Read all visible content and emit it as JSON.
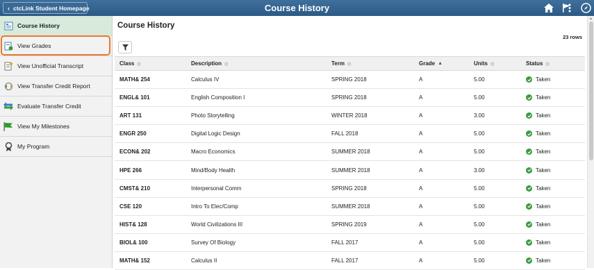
{
  "banner": {
    "back_label": "ctcLink Student Homepage",
    "title": "Course History",
    "color": "#2c5a86"
  },
  "sidebar": {
    "items": [
      {
        "label": "Course History",
        "icon": "course-history-icon",
        "active": true
      },
      {
        "label": "View Grades",
        "icon": "view-grades-icon",
        "active": false
      },
      {
        "label": "View Unofficial Transcript",
        "icon": "transcript-icon",
        "active": false
      },
      {
        "label": "View Transfer Credit Report",
        "icon": "transfer-report-icon",
        "active": false
      },
      {
        "label": "Evaluate Transfer Credit",
        "icon": "evaluate-transfer-icon",
        "active": false
      },
      {
        "label": "View My Milestones",
        "icon": "flag-icon",
        "active": false
      },
      {
        "label": "My Program",
        "icon": "ribbon-icon",
        "active": false
      }
    ]
  },
  "main": {
    "title": "Course History",
    "row_count": "23 rows",
    "columns": [
      "Class",
      "Description",
      "Term",
      "Grade",
      "Units",
      "Status"
    ],
    "rows": [
      {
        "class": "MATH& 254",
        "description": "Calculus IV",
        "term": "SPRING 2018",
        "grade": "A",
        "units": "5.00",
        "status": "Taken"
      },
      {
        "class": "ENGL& 101",
        "description": "English Composition I",
        "term": "SPRING 2018",
        "grade": "A",
        "units": "5.00",
        "status": "Taken"
      },
      {
        "class": "ART 131",
        "description": "Photo Storytelling",
        "term": "WINTER 2018",
        "grade": "A",
        "units": "3.00",
        "status": "Taken"
      },
      {
        "class": "ENGR 250",
        "description": "Digital Logic Design",
        "term": "FALL 2018",
        "grade": "A",
        "units": "5.00",
        "status": "Taken"
      },
      {
        "class": "ECON& 202",
        "description": "Macro Economics",
        "term": "SUMMER 2018",
        "grade": "A",
        "units": "5.00",
        "status": "Taken"
      },
      {
        "class": "HPE 266",
        "description": "Mind/Body Health",
        "term": "SUMMER 2018",
        "grade": "A",
        "units": "3.00",
        "status": "Taken"
      },
      {
        "class": "CMST& 210",
        "description": "Interpersonal Comm",
        "term": "SPRING 2018",
        "grade": "A",
        "units": "5.00",
        "status": "Taken"
      },
      {
        "class": "CSE 120",
        "description": "Intro To Elec/Comp",
        "term": "SUMMER 2018",
        "grade": "A",
        "units": "5.00",
        "status": "Taken"
      },
      {
        "class": "HIST& 128",
        "description": "World Civilizations III",
        "term": "SPRING 2019",
        "grade": "A",
        "units": "5.00",
        "status": "Taken"
      },
      {
        "class": "BIOL& 100",
        "description": "Survey Of Biology",
        "term": "FALL 2017",
        "grade": "A",
        "units": "5.00",
        "status": "Taken"
      },
      {
        "class": "MATH& 152",
        "description": "Calculus II",
        "term": "FALL 2017",
        "grade": "A",
        "units": "5.00",
        "status": "Taken"
      }
    ]
  }
}
